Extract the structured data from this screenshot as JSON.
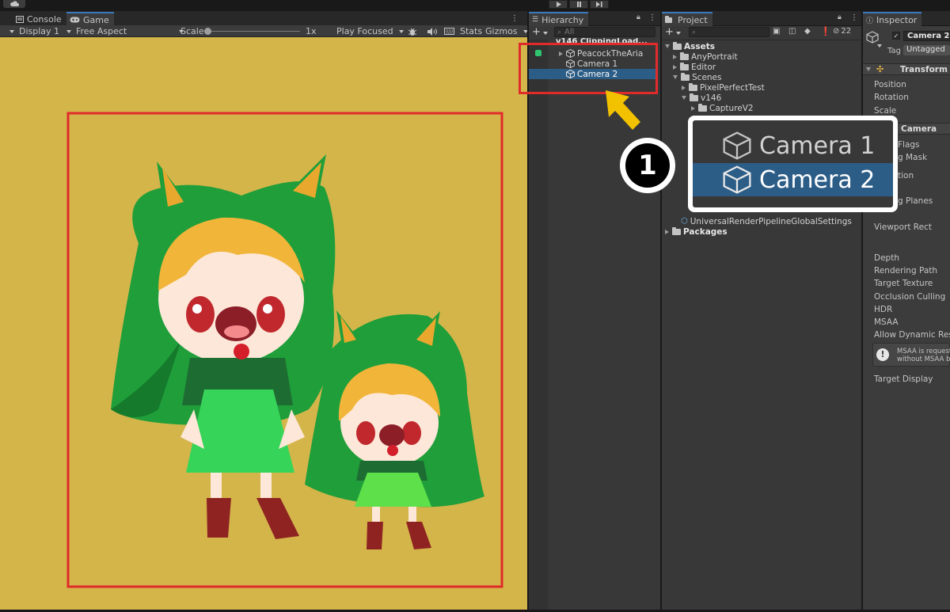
{
  "game_panel": {
    "tabs": [
      {
        "label": "Console",
        "icon": "console-icon"
      },
      {
        "label": "Game",
        "icon": "gamepad-icon"
      }
    ],
    "display": "Display 1",
    "aspect": "Free Aspect",
    "scale_label": "Scale",
    "scale_value": "1x",
    "play_mode": "Play Focused",
    "stats_label": "Stats",
    "gizmos_label": "Gizmos"
  },
  "hierarchy": {
    "title": "Hierarchy",
    "search_placeholder": "All",
    "scene_name": "v146 ClippingLoad...",
    "items": [
      "PeacockTheAria",
      "Camera 1",
      "Camera 2"
    ],
    "selected": "Camera 2"
  },
  "project": {
    "title": "Project",
    "visible_count": "22",
    "tree": {
      "assets": "Assets",
      "anyportrait": "AnyPortrait",
      "editor": "Editor",
      "scenes": "Scenes",
      "pixelperfect": "PixelPerfectTest",
      "v146": "v146",
      "capturev2": "CaptureV2",
      "urp_settings": "UniversalRenderPipelineGlobalSettings",
      "packages": "Packages"
    }
  },
  "inspector": {
    "title": "Inspector",
    "object_name": "Camera 2",
    "tag_label": "Tag",
    "tag_value": "Untagged",
    "transform_title": "Transform",
    "transform_fields": [
      "Position",
      "Rotation",
      "Scale"
    ],
    "camera_title": "Camera",
    "camera_fields_partial": [
      "Flags",
      "g Mask",
      "tion",
      "g Planes"
    ],
    "viewport_rect": "Viewport Rect",
    "camera_fields": [
      "Depth",
      "Rendering Path",
      "Target Texture",
      "Occlusion Culling",
      "HDR",
      "MSAA",
      "Allow Dynamic Resol"
    ],
    "msaa_note_1": "MSAA is requeste",
    "msaa_note_2": "without MSAA bu",
    "target_display": "Target Display"
  },
  "callout": {
    "step_number": "1",
    "zoom_items": [
      "Camera 1",
      "Camera 2"
    ],
    "highlight_color": "#e02b2b",
    "arrow_color": "#f2c200",
    "selection_color": "#2c5d87"
  }
}
